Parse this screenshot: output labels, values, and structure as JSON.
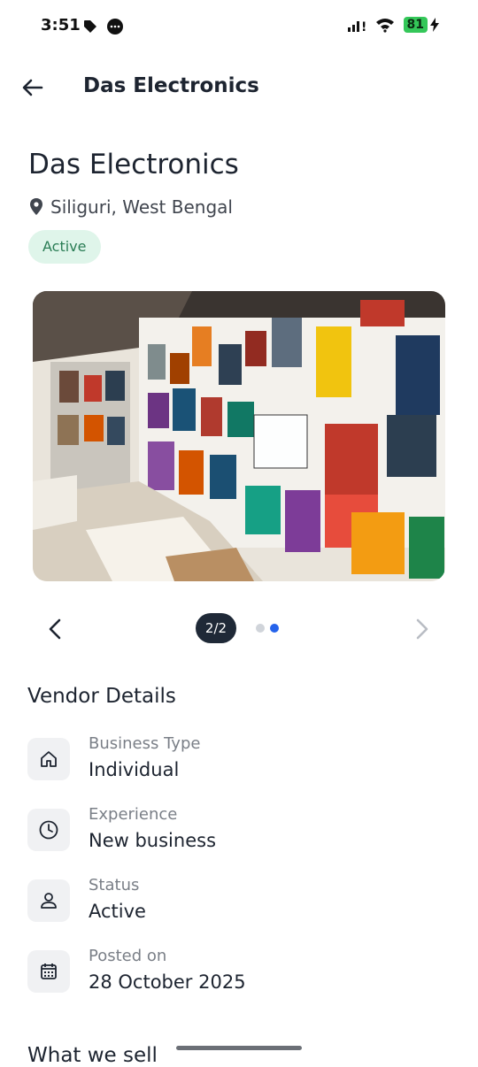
{
  "status_bar": {
    "time": "3:51",
    "left_icons": [
      "tag-icon",
      "message-bubble-icon"
    ],
    "right_icons": [
      "signal-icon",
      "wifi-icon",
      "battery-icon",
      "charging-bolt-icon"
    ],
    "battery_level": "81"
  },
  "header": {
    "title": "Das Electronics",
    "back_icon": "arrow-left-icon"
  },
  "shop": {
    "name": "Das Electronics",
    "location": "Siliguri, West Bengal",
    "location_icon": "map-pin-icon",
    "status_badge": "Active"
  },
  "gallery": {
    "image_description_icon": "shop-photo",
    "counter": "2/2",
    "dots": [
      false,
      true
    ],
    "prev_icon": "chevron-left-icon",
    "next_icon": "chevron-right-icon"
  },
  "vendor_details": {
    "title": "Vendor Details",
    "items": [
      {
        "label": "Business Type",
        "value": "Individual",
        "icon": "home-icon"
      },
      {
        "label": "Experience",
        "value": "New business",
        "icon": "clock-icon"
      },
      {
        "label": "Status",
        "value": "Active",
        "icon": "user-icon"
      },
      {
        "label": "Posted on",
        "value": "28 October 2025",
        "icon": "calendar-icon"
      }
    ]
  },
  "next_section_title": "What we sell",
  "colors": {
    "badge_bg": "#dff5ea",
    "badge_text": "#2a7d55",
    "accent_dot": "#2563eb",
    "counter_bg": "#1f2937",
    "battery": "#34c759"
  }
}
